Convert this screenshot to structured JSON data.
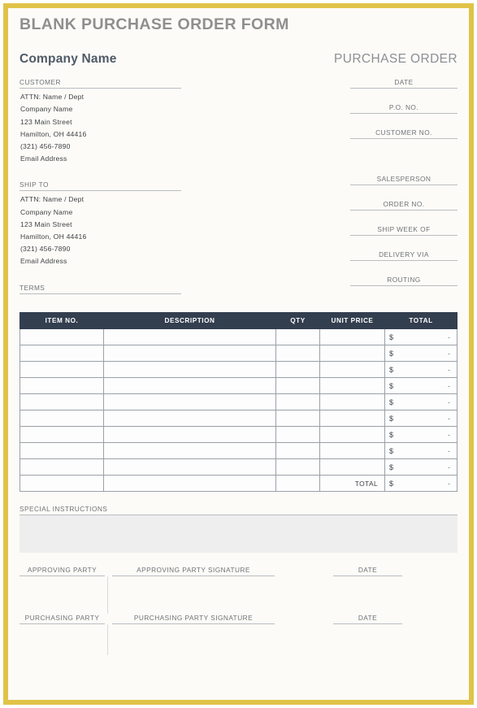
{
  "document": {
    "title": "BLANK PURCHASE ORDER FORM",
    "company_name": "Company Name",
    "po_heading": "PURCHASE ORDER"
  },
  "customer": {
    "label": "CUSTOMER",
    "lines": [
      "ATTN: Name / Dept",
      "Company Name",
      "123 Main Street",
      "Hamilton, OH  44416",
      "(321) 456-7890",
      "Email Address"
    ]
  },
  "ship_to": {
    "label": "SHIP TO",
    "lines": [
      "ATTN: Name / Dept",
      "Company Name",
      "123 Main Street",
      "Hamilton, OH  44416",
      "(321) 456-7890",
      "Email Address"
    ]
  },
  "terms": {
    "label": "TERMS",
    "value": ""
  },
  "order_fields": [
    {
      "label": "DATE",
      "value": ""
    },
    {
      "label": "P.O. NO.",
      "value": ""
    },
    {
      "label": "CUSTOMER NO.",
      "value": ""
    },
    {
      "label": "SALESPERSON",
      "value": ""
    },
    {
      "label": "ORDER NO.",
      "value": ""
    },
    {
      "label": "SHIP WEEK OF",
      "value": ""
    },
    {
      "label": "DELIVERY VIA",
      "value": ""
    },
    {
      "label": "ROUTING",
      "value": ""
    }
  ],
  "items_table": {
    "columns": [
      "ITEM NO.",
      "DESCRIPTION",
      "QTY",
      "UNIT PRICE",
      "TOTAL"
    ],
    "row_count": 9,
    "rows": [
      {
        "item_no": "",
        "description": "",
        "qty": "",
        "unit_price": "",
        "total_currency": "$",
        "total_value": "-"
      },
      {
        "item_no": "",
        "description": "",
        "qty": "",
        "unit_price": "",
        "total_currency": "$",
        "total_value": "-"
      },
      {
        "item_no": "",
        "description": "",
        "qty": "",
        "unit_price": "",
        "total_currency": "$",
        "total_value": "-"
      },
      {
        "item_no": "",
        "description": "",
        "qty": "",
        "unit_price": "",
        "total_currency": "$",
        "total_value": "-"
      },
      {
        "item_no": "",
        "description": "",
        "qty": "",
        "unit_price": "",
        "total_currency": "$",
        "total_value": "-"
      },
      {
        "item_no": "",
        "description": "",
        "qty": "",
        "unit_price": "",
        "total_currency": "$",
        "total_value": "-"
      },
      {
        "item_no": "",
        "description": "",
        "qty": "",
        "unit_price": "",
        "total_currency": "$",
        "total_value": "-"
      },
      {
        "item_no": "",
        "description": "",
        "qty": "",
        "unit_price": "",
        "total_currency": "$",
        "total_value": "-"
      },
      {
        "item_no": "",
        "description": "",
        "qty": "",
        "unit_price": "",
        "total_currency": "$",
        "total_value": "-"
      }
    ],
    "summary": {
      "label": "TOTAL",
      "currency": "$",
      "value": "-"
    }
  },
  "special_instructions": {
    "label": "SPECIAL INSTRUCTIONS",
    "value": ""
  },
  "signatures": [
    {
      "party_label": "APPROVING PARTY",
      "signature_label": "APPROVING PARTY SIGNATURE",
      "date_label": "DATE",
      "party_value": "",
      "signature_value": "",
      "date_value": ""
    },
    {
      "party_label": "PURCHASING PARTY",
      "signature_label": "PURCHASING PARTY SIGNATURE",
      "date_label": "DATE",
      "party_value": "",
      "signature_value": "",
      "date_value": ""
    }
  ],
  "colors": {
    "border_accent": "#e0c348",
    "table_header": "#333e4f",
    "page_background": "#fdfbf7",
    "title_text": "#8f8f8f",
    "company_text": "#4e5a66"
  }
}
